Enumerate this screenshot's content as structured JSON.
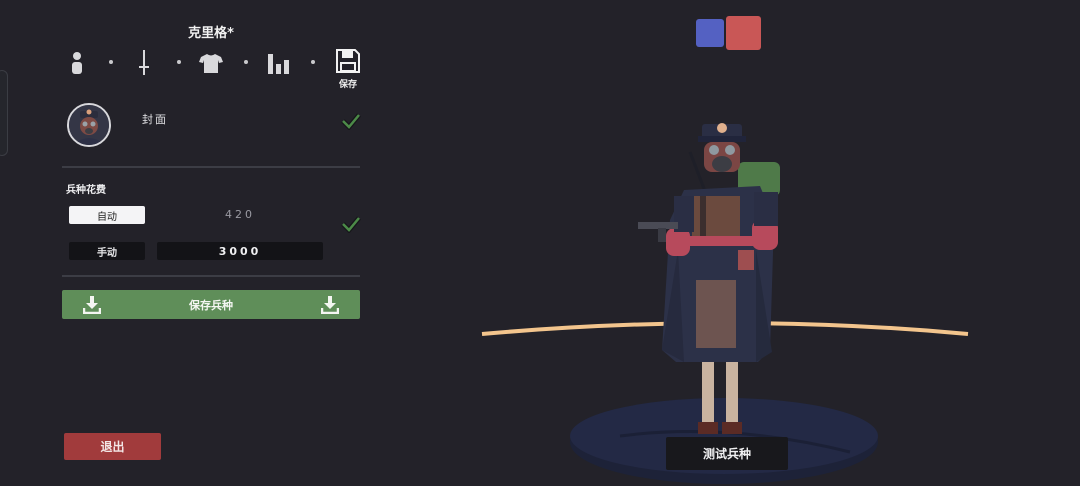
{
  "editor": {
    "unit_name": "克里格*",
    "tabs": [
      {
        "name": "body",
        "icon": "person-icon"
      },
      {
        "name": "weapon",
        "icon": "sword-icon"
      },
      {
        "name": "clothing",
        "icon": "shirt-icon"
      },
      {
        "name": "stats",
        "icon": "bar-chart-icon"
      },
      {
        "name": "save",
        "icon": "floppy-disk-icon"
      }
    ],
    "save_tab_label": "保存",
    "cover_label": "封面",
    "cost": {
      "label": "兵种花费",
      "auto_label": "自动",
      "auto_value": "420",
      "manual_label": "手动",
      "manual_value": "3000"
    },
    "save_unit_label": "保存兵种",
    "exit_label": "退出"
  },
  "scene": {
    "team_colors": [
      "#5461c2",
      "#c95756"
    ],
    "test_unit_label": "测试兵种"
  },
  "colors": {
    "background": "#232229",
    "save_green": "#5f8e59",
    "exit_red": "#a13b3c",
    "check_green": "#4c8a48"
  }
}
